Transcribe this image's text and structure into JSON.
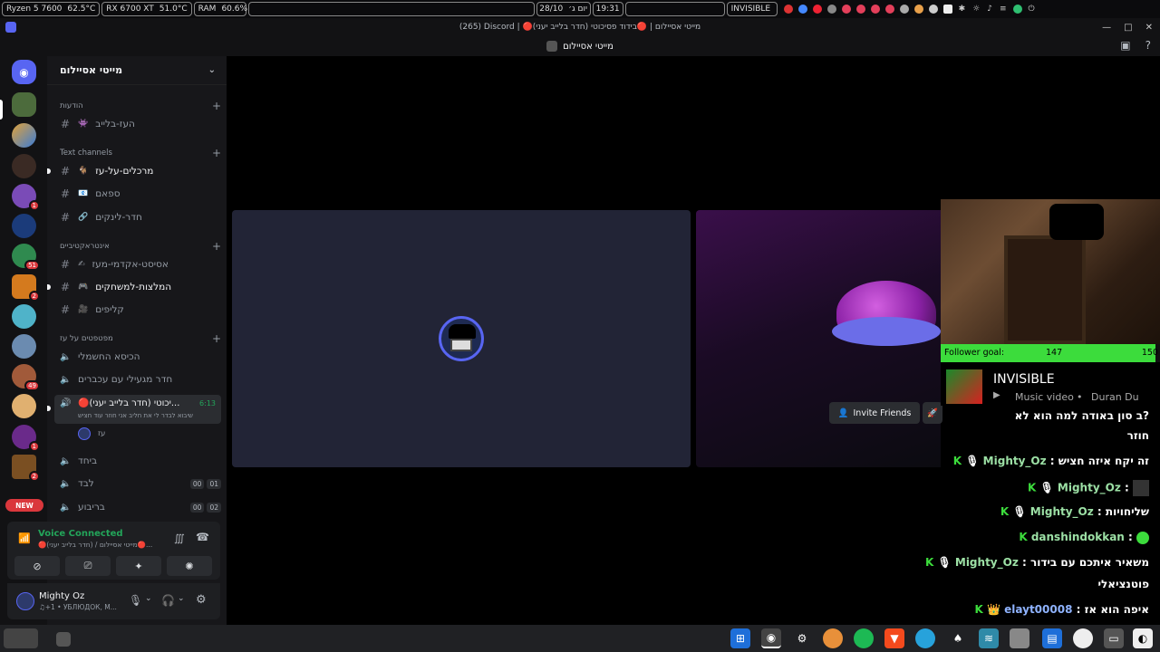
{
  "system_bar": {
    "cpu": "Ryzen 5 7600",
    "cpu_temp": "62.5°C",
    "gpu": "RX 6700 XT",
    "gpu_temp": "51.0°C",
    "ram_label": "RAM",
    "ram_value": "60.6%",
    "date": "28/10",
    "day": "יום ג׳",
    "time": "19:31",
    "stream_label": "INVISIBLE"
  },
  "titlebar": {
    "title": "(265) Discord | 🔴מייטי אסיילום | 🔴בידוד פסיכוטי (חדר בלייב יעני)"
  },
  "header": {
    "channel": "מייטי אסיילום"
  },
  "server": {
    "name": "מייטי אסיילום"
  },
  "guild_badges": {
    "g4": "1",
    "g6": "51",
    "g7": "2",
    "g10": "49",
    "g12": "1",
    "g13": "2",
    "new": "NEW"
  },
  "categories": {
    "announcements": "הודעות",
    "text": "Text channels",
    "interactive": "אינטראקטיביים",
    "oz": "מפטפטים על עז"
  },
  "channels": {
    "live": "העז-בלייב",
    "marcelim": "מרכלים-על-עז",
    "spam": "ספאם",
    "links": "חדר-לינקים",
    "assist": "אסיסט-אקדמי-מעז",
    "recommend": "המלצות-למשחקים",
    "clips": "קליפים",
    "chair": "הכיסא החשמלי",
    "disgusting": "חדר מגעילי עם עכברים",
    "isolation": "🔴בידוד פסיכוטי (חדר בלייב יעני)",
    "isolation_short": "🔴יכוטי (חדר בלייב יעני)...",
    "isolation_time": "6:13",
    "isolation_sub": "שיבוא לבדר לי את חליב אני חוזר עוד חציש",
    "isolation_user": "עז",
    "together": "ביחד",
    "alone": "לבד",
    "alone_count_a": "00",
    "alone_count_b": "01",
    "quad": "בריבוע",
    "quad_count_a": "00",
    "quad_count_b": "02"
  },
  "voice": {
    "status": "Voice Connected",
    "location": "🔴מייטי אסיילום / (חדר בלייב יעני)🔴..."
  },
  "user": {
    "name": "Mighty Oz",
    "status": "♫+1 • УБЛЮДОК, M..."
  },
  "main": {
    "invite_label": "Invite Friends"
  },
  "overlay": {
    "goal_label": "Follower goal:",
    "goal_current": "147",
    "goal_target": "150",
    "goal_fraction": 0.98,
    "song_title": "INVISIBLE",
    "song_type": "Music video",
    "song_artist": "Duran Du"
  },
  "chat": [
    {
      "user": "",
      "text": "ב סון באודה למה הוא לא?"
    },
    {
      "user": "",
      "text": "חוזר"
    },
    {
      "user": "Mighty_Oz",
      "text": "זה יקח איזה חציש"
    },
    {
      "user": "Mighty_Oz",
      "text": ""
    },
    {
      "user": "Mighty_Oz",
      "text": "שליחויות"
    },
    {
      "user": "danshindokkan",
      "text": ""
    },
    {
      "user": "Mighty_Oz",
      "text": "משאיר איתכם עם בידור"
    },
    {
      "user": "",
      "text": "פוטנציאלי"
    },
    {
      "user": "elayt00008",
      "text": "איפה הוא אז"
    }
  ],
  "colors": {
    "discord_blurple": "#5865f2",
    "voice_green": "#23a55a",
    "goal_green": "#3cdc3c",
    "danger_red": "#da373c"
  }
}
